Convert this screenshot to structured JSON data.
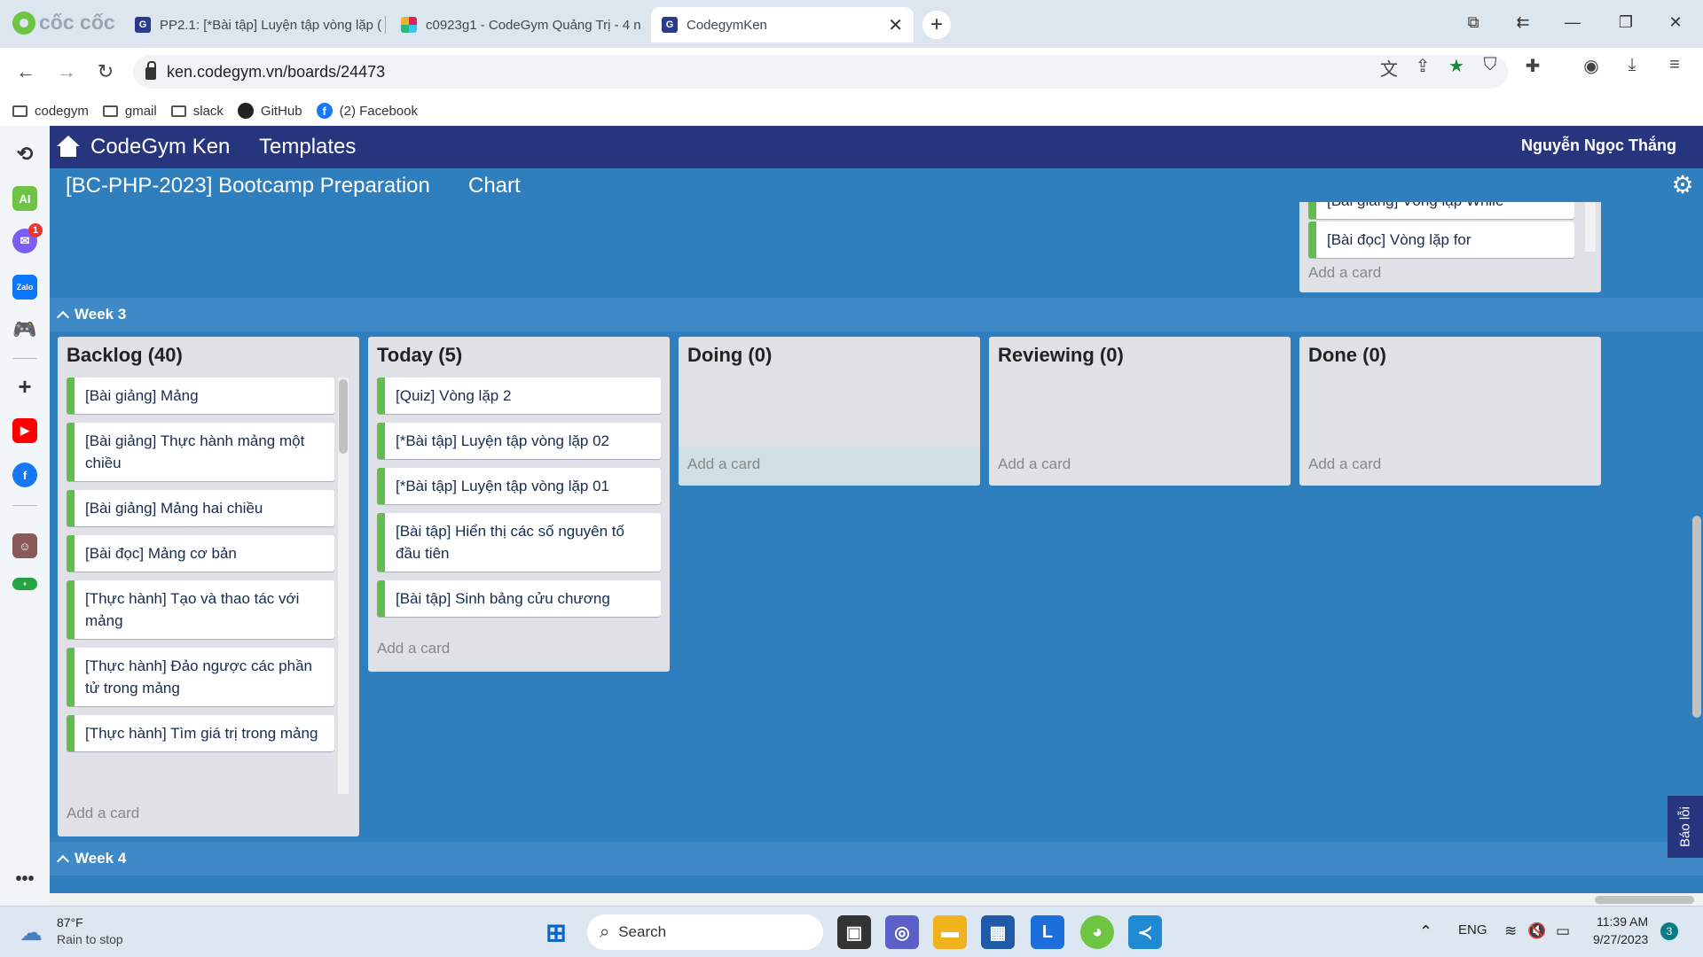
{
  "browser": {
    "brand": "cốc cốc",
    "tabs": [
      {
        "favicon": "G",
        "title": "PP2.1: [*Bài tập] Luyện tập vòng lặp (",
        "active": false
      },
      {
        "favicon": "slack",
        "title": "c0923g1 - CodeGym Quảng Trị - 4 n",
        "active": false
      },
      {
        "favicon": "G",
        "title": "CodegymKen",
        "active": true
      }
    ],
    "url": "ken.codegym.vn/boards/24473",
    "bookmarks": [
      {
        "icon": "folder-icon",
        "label": "codegym"
      },
      {
        "icon": "folder-icon",
        "label": "gmail"
      },
      {
        "icon": "folder-icon",
        "label": "slack"
      },
      {
        "icon": "github-icon",
        "label": "GitHub"
      },
      {
        "icon": "facebook-icon",
        "label": "(2) Facebook"
      }
    ],
    "side_badge": "1",
    "side_ai": "AI",
    "side_zalo": "Zalo"
  },
  "app": {
    "brand": "CodeGym Ken",
    "templates": "Templates",
    "user": "Nguyễn Ngọc Thắng",
    "board_title": "[BC-PHP-2023] Bootcamp Preparation",
    "chart_link": "Chart",
    "report_button": "Báo lỗi"
  },
  "upper_list": {
    "cards": [
      "[Bài giảng] Vòng lặp While",
      "[Bài đọc] Vòng lặp for"
    ],
    "add_card": "Add a card"
  },
  "week3": {
    "label": "Week 3",
    "lists": [
      {
        "title": "Backlog (40)",
        "cards": [
          "[Bài giảng] Mảng",
          "[Bài giảng] Thực hành mảng một chiều",
          "[Bài giảng] Mảng hai chiều",
          "[Bài đọc] Mảng cơ bản",
          "[Thực hành] Tạo và thao tác với mảng",
          "[Thực hành] Đảo ngược các phần tử trong mảng",
          "[Thực hành] Tìm giá trị trong mảng"
        ],
        "add_card": "Add a card"
      },
      {
        "title": "Today (5)",
        "cards": [
          "[Quiz] Vòng lặp 2",
          "[*Bài tập] Luyện tập vòng lặp 02",
          "[*Bài tập] Luyện tập vòng lặp 01",
          "[Bài tập] Hiển thị các số nguyên tố đầu tiên",
          "[Bài tập] Sinh bảng cửu chương"
        ],
        "add_card": "Add a card"
      },
      {
        "title": "Doing (0)",
        "cards": [],
        "add_card": "Add a card"
      },
      {
        "title": "Reviewing (0)",
        "cards": [],
        "add_card": "Add a card"
      },
      {
        "title": "Done (0)",
        "cards": [],
        "add_card": "Add a card"
      }
    ]
  },
  "week4": {
    "label": "Week 4"
  },
  "taskbar": {
    "weather_temp": "87°F",
    "weather_desc": "Rain to stop",
    "search": "Search",
    "lang": "ENG",
    "time": "11:39 AM",
    "date": "9/27/2023",
    "notif": "3"
  },
  "colors": {
    "nav": "#27357f",
    "board": "#2f7ebd",
    "label_green": "#61bd4f"
  }
}
